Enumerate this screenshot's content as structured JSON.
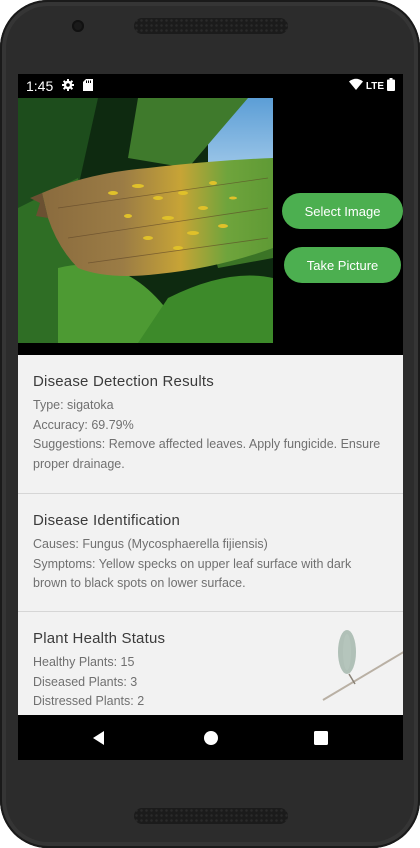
{
  "status_bar": {
    "time": "1:45",
    "network": "LTE",
    "icons": [
      "gear-icon",
      "sd-card-icon",
      "wifi-icon",
      "signal-icon",
      "battery-icon"
    ]
  },
  "image": {
    "subject": "banana-leaf-disease-photo"
  },
  "buttons": {
    "select_image": "Select Image",
    "take_picture": "Take Picture",
    "color": "#4caf50"
  },
  "detection": {
    "title": "Disease Detection Results",
    "type": "Type: sigatoka",
    "accuracy": "Accuracy: 69.79%",
    "suggestions": "Suggestions: Remove affected leaves. Apply fungicide. Ensure proper drainage."
  },
  "identification": {
    "title": "Disease Identification",
    "causes": "Causes: Fungus (Mycosphaerella fijiensis)",
    "symptoms": "Symptoms: Yellow specks on upper leaf surface with dark brown to black spots on lower surface."
  },
  "health": {
    "title": "Plant Health Status",
    "healthy": "Healthy Plants: 15",
    "diseased": "Diseased Plants: 3",
    "distressed": "Distressed Plants: 2"
  },
  "nav": {
    "icons": [
      "back-icon",
      "home-icon",
      "recents-icon"
    ]
  }
}
